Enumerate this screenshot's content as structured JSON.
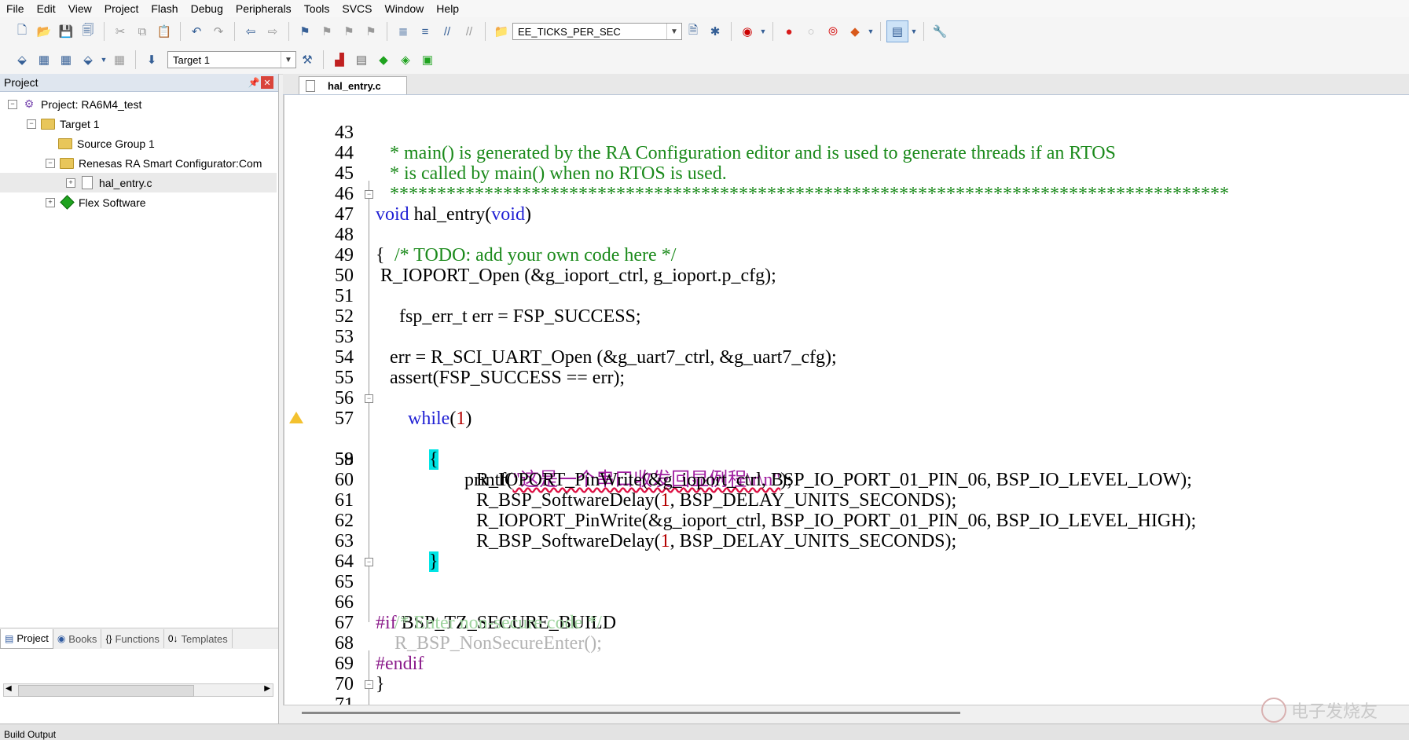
{
  "menubar": [
    "File",
    "Edit",
    "View",
    "Project",
    "Flash",
    "Debug",
    "Peripherals",
    "Tools",
    "SVCS",
    "Window",
    "Help"
  ],
  "toolbar": {
    "define_combo": "EE_TICKS_PER_SEC",
    "target_combo": "Target 1"
  },
  "project_panel": {
    "title": "Project",
    "tree": {
      "project": "Project: RA6M4_test",
      "target": "Target 1",
      "source_group": "Source Group 1",
      "configurator": "Renesas RA Smart Configurator:Com",
      "file": "hal_entry.c",
      "flex": "Flex Software"
    },
    "tabs": [
      "Project",
      "Books",
      "Functions",
      "Templates"
    ]
  },
  "editor": {
    "tab": "hal_entry.c",
    "lines": [
      {
        "n": "43",
        "text": " * main() is generated by the RA Configuration editor and is used to generate threads if an RTOS"
      },
      {
        "n": "44",
        "text": " * is called by main() when no RTOS is used."
      },
      {
        "n": "45",
        "text": " *****************************************************************************************"
      },
      {
        "n": "46",
        "a": "void",
        "b": " hal_entry(",
        "c": "void",
        "d": ")"
      },
      {
        "n": "47",
        "text": "{"
      },
      {
        "n": "48",
        "text": "    /* TODO: add your own code here */"
      },
      {
        "n": "49",
        "text": " R_IOPORT_Open (&g_ioport_ctrl, g_ioport.p_cfg);"
      },
      {
        "n": "50",
        "text": ""
      },
      {
        "n": "51",
        "text": "     fsp_err_t err = FSP_SUCCESS;"
      },
      {
        "n": "52",
        "text": ""
      },
      {
        "n": "53",
        "text": "   err = R_SCI_UART_Open (&g_uart7_ctrl, &g_uart7_cfg);"
      },
      {
        "n": "54",
        "text": "   assert(FSP_SUCCESS == err);"
      },
      {
        "n": "55",
        "text": ""
      },
      {
        "n": "56",
        "a": "while",
        "b": "(",
        "c": "1",
        "d": ")"
      },
      {
        "n": "57",
        "text": "{"
      },
      {
        "n": "58",
        "a": "printf(",
        "b": "\"这是一个串口收发回显例程\\r\\n\"",
        "c": ");"
      },
      {
        "n": "59",
        "text": "R_IOPORT_PinWrite(&g_ioport_ctrl, BSP_IO_PORT_01_PIN_06, BSP_IO_LEVEL_LOW);"
      },
      {
        "n": "60",
        "a": "R_BSP_SoftwareDelay(",
        "b": "1",
        "c": ", BSP_DELAY_UNITS_SECONDS);"
      },
      {
        "n": "61",
        "text": "R_IOPORT_PinWrite(&g_ioport_ctrl, BSP_IO_PORT_01_PIN_06, BSP_IO_LEVEL_HIGH);"
      },
      {
        "n": "62",
        "a": "R_BSP_SoftwareDelay(",
        "b": "1",
        "c": ", BSP_DELAY_UNITS_SECONDS);"
      },
      {
        "n": "63",
        "text": "}"
      },
      {
        "n": "64",
        "text": ""
      },
      {
        "n": "65",
        "a": "#if",
        "b": " BSP_TZ_SECURE_BUILD"
      },
      {
        "n": "66",
        "text": "    /* Enter non-secure code */"
      },
      {
        "n": "67",
        "text": "    R_BSP_NonSecureEnter();"
      },
      {
        "n": "68",
        "text": "#endif"
      },
      {
        "n": "69",
        "text": "}"
      },
      {
        "n": "70",
        "text": ""
      },
      {
        "n": "71",
        "text": "/*****************************************************************************************"
      }
    ]
  },
  "status": {
    "build_output": "Build Output"
  },
  "watermark": "电子发烧友",
  "colors": {
    "comment": "#1b8a1b",
    "keyword": "#1f1fd4",
    "string": "#a01fa0",
    "brace_highlight": "#00e5e5"
  }
}
